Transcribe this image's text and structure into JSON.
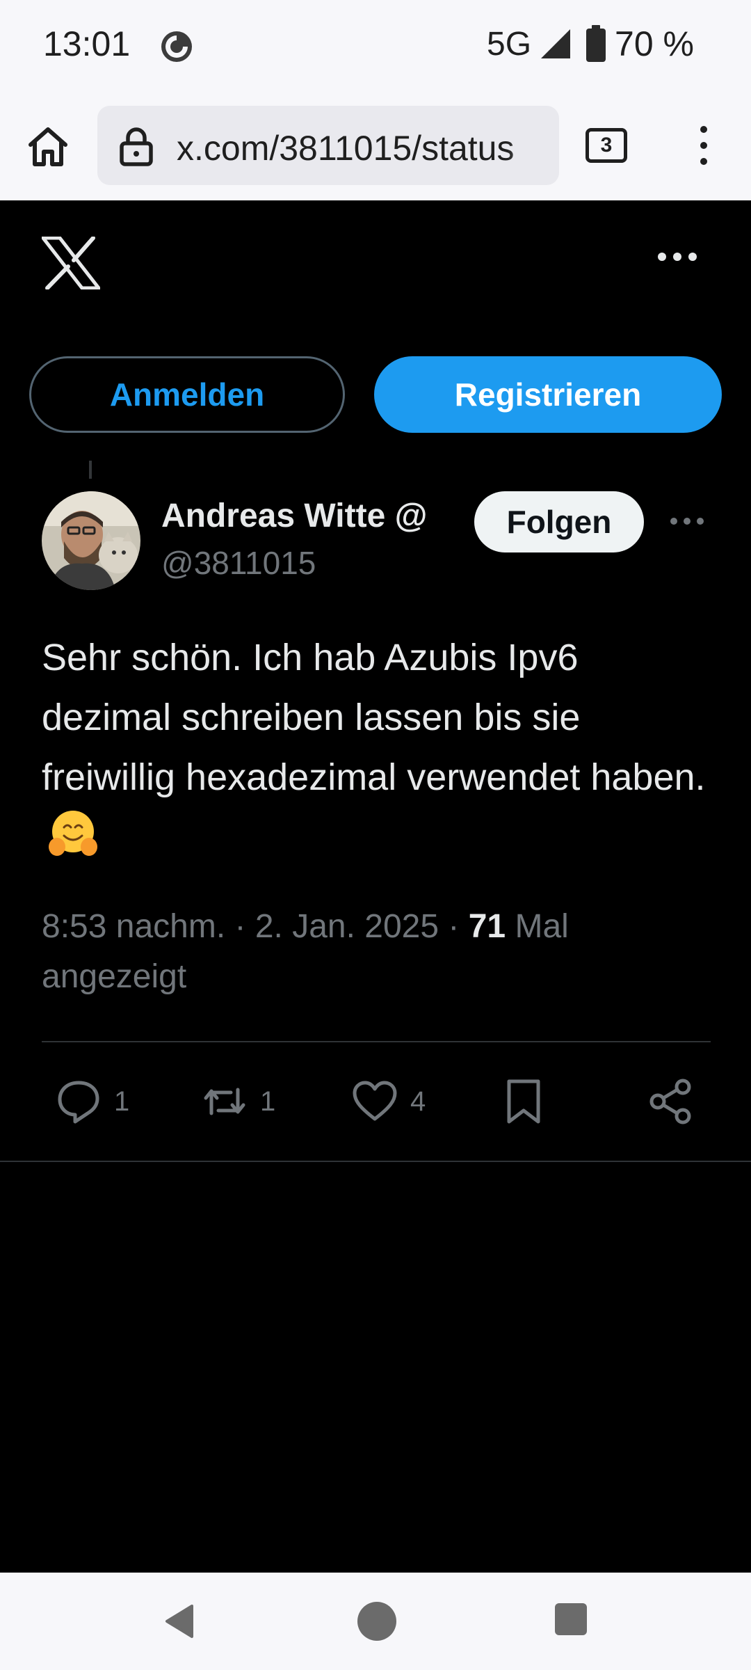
{
  "status_bar": {
    "time": "13:01",
    "network": "5G",
    "battery": "70 %",
    "icons": [
      "app-notification-icon",
      "cell-signal-icon",
      "battery-icon"
    ]
  },
  "browser": {
    "url": "x.com/3811015/status",
    "tab_count": "3",
    "icons": [
      "home-icon",
      "lock-icon",
      "overflow-menu-icon"
    ]
  },
  "page": {
    "login_label": "Anmelden",
    "signup_label": "Registrieren",
    "accent_color": "#1d9bf0"
  },
  "tweet": {
    "author_name": "Andreas Witte @",
    "author_handle": "@3811015",
    "follow_label": "Folgen",
    "text": "Sehr schön. Ich hab Azubis Ipv6 dezimal schreiben lassen bis sie freiwillig hexadezimal verwendet haben.",
    "emoji_icon": "hugging-face-emoji",
    "time": "8:53 nachm.",
    "separator": "·",
    "date": "2. Jan. 2025",
    "views_count": "71",
    "views_label": "Mal angezeigt",
    "reply_count": "1",
    "retweet_count": "1",
    "like_count": "4"
  }
}
